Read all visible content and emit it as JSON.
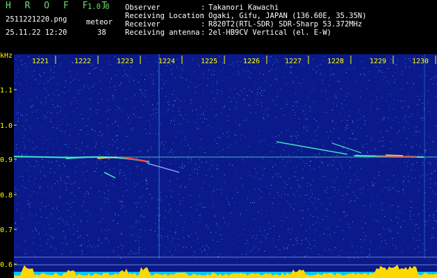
{
  "header": {
    "app_name": "H R O F F T",
    "version": "1.0.0",
    "filename": "2511221220.png",
    "datetime": "25.11.22 12:20",
    "meteor_label": "meteor",
    "meteor_count": "38"
  },
  "info": [
    {
      "label": "Observer",
      "value": "Takanori Kawachi"
    },
    {
      "label": "Receiving Location",
      "value": "Ogaki, Gifu, JAPAN (136.60E, 35.35N)"
    },
    {
      "label": "Receiver",
      "value": "R820T2(RTL-SDR) SDR-Sharp 53.372MHz"
    },
    {
      "label": "Receiving antenna",
      "value": "2el-HB9CV Vertical (el. E-W)"
    }
  ],
  "spectrogram": {
    "y_unit": "kHz",
    "y_ticks": [
      "1.1",
      "1.0",
      "0.9",
      "0.8",
      "0.7",
      "0.6"
    ],
    "x_ticks": [
      "1221",
      "1222",
      "1223",
      "1224",
      "1225",
      "1226",
      "1227",
      "1228",
      "1229",
      "1230"
    ],
    "colors": {
      "background": "#0a1a8a",
      "label": "#ffff00",
      "trace": "#40e0c0",
      "echo": "#ff4040",
      "noise_band": "#ffd800",
      "floor": "#00c8ff"
    }
  }
}
